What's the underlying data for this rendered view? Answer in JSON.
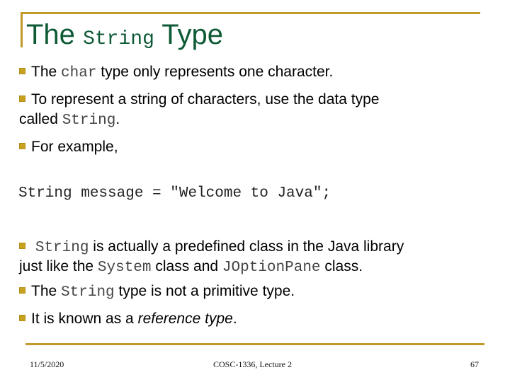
{
  "slide": {
    "title": {
      "part1": "The",
      "code": "String",
      "part2": "Type"
    },
    "bullets": [
      {
        "pre": "The ",
        "code": "char",
        "post": " type only represents one character."
      },
      {
        "line1": "To represent a string of characters, use the data type",
        "line2_pre": "called ",
        "line2_code": "String",
        "line2_post": "."
      },
      {
        "text": "For example,"
      }
    ],
    "code_example": "String message = \"Welcome to Java\";",
    "bullets2": [
      {
        "code": "String",
        "line1_post": " is actually a predefined class in the Java library",
        "line2_pre": "just like the ",
        "line2_code1": "System",
        "line2_mid": " class and ",
        "line2_code2": "JOptionPane",
        "line2_post": " class."
      },
      {
        "pre": "The ",
        "code": "String",
        "post": " type is not a primitive type."
      },
      {
        "pre": "It is known as a ",
        "em": "reference type",
        "post": "."
      }
    ],
    "footer": {
      "date": "11/5/2020",
      "course": "COSC-1336, Lecture 2",
      "page": "67"
    },
    "colors": {
      "accent": "#c09a2a",
      "title": "#0e5a35",
      "bullet": "#c8a21e"
    }
  }
}
